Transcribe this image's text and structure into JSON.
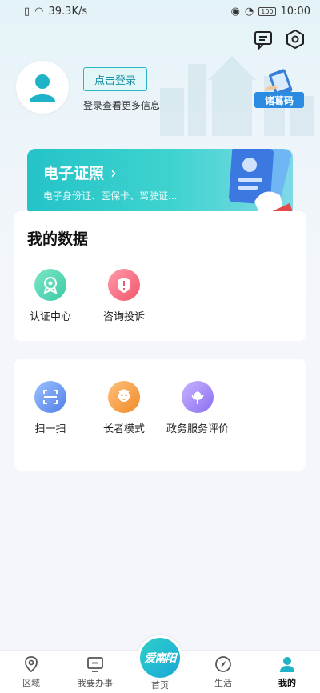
{
  "status_bar": {
    "speed": "39.3K/s",
    "battery": "100",
    "time": "10:00"
  },
  "profile": {
    "login_button": "点击登录",
    "login_hint": "登录查看更多信息",
    "zhuge_code": "诸葛码"
  },
  "cert_card": {
    "title": "电子证照",
    "subtitle": "电子身份证、医保卡、驾驶证..."
  },
  "my_data": {
    "title": "我的数据",
    "items": [
      {
        "label": "认证中心",
        "icon": "badge-icon"
      },
      {
        "label": "咨询投诉",
        "icon": "shield-alert-icon"
      }
    ]
  },
  "services": {
    "items": [
      {
        "label": "扫一扫",
        "icon": "scan-icon"
      },
      {
        "label": "长者模式",
        "icon": "elder-icon"
      },
      {
        "label": "政务服务评价",
        "icon": "flower-icon"
      }
    ]
  },
  "bottom_nav": {
    "items": [
      {
        "label": "区域",
        "icon": "location-icon"
      },
      {
        "label": "我要办事",
        "icon": "monitor-icon"
      },
      {
        "label": "首页",
        "icon": "home-logo"
      },
      {
        "label": "生活",
        "icon": "compass-icon"
      },
      {
        "label": "我的",
        "icon": "user-icon",
        "active": true
      }
    ],
    "center_logo_text": "爱南阳"
  },
  "colors": {
    "accent": "#24c3c8",
    "login_border": "#2bb7c9",
    "zhuge_blue": "#2a8be0"
  }
}
